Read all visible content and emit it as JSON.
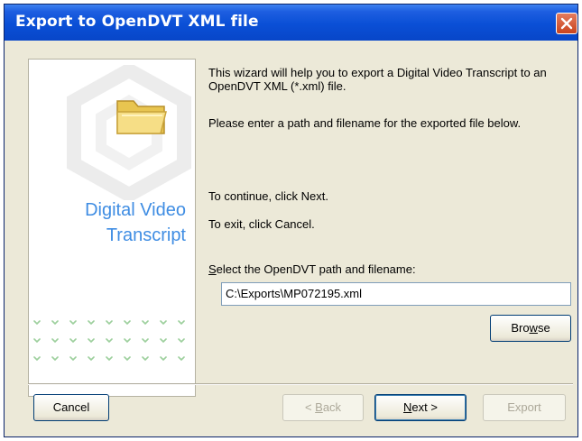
{
  "window": {
    "title": "Export to OpenDVT XML file",
    "title_bar_color": "#0a4fd6",
    "close_icon": "close-icon"
  },
  "side_panel": {
    "brand_line1": "Digital Video",
    "brand_line2": "Transcript",
    "brand_color": "#3f8de3",
    "icon": "folder-icon"
  },
  "content": {
    "intro": "This wizard will help you to export a Digital Video Transcript to an OpenDVT XML (*.xml) file.",
    "instruction": "Please enter a path and filename for the exported file below.",
    "continue_text": "To continue, click Next.",
    "exit_text": "To exit, click Cancel.",
    "path_label": "Select the OpenDVT path and filename:",
    "path_label_mnemonic": "S",
    "path_label_rest": "elect the OpenDVT path and filename:",
    "path_value": "C:\\Exports\\MP072195.xml"
  },
  "buttons": {
    "browse_pre": "Bro",
    "browse_mnemonic": "w",
    "browse_post": "se",
    "cancel": "Cancel",
    "back_pre": "< ",
    "back_mnemonic": "B",
    "back_post": "ack",
    "next_mnemonic": "N",
    "next_post": "ext >",
    "export": "Export"
  }
}
